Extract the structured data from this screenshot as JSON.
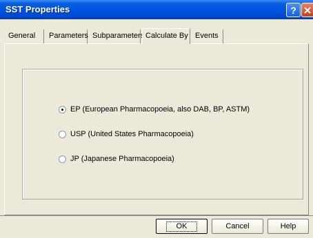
{
  "window": {
    "title": "SST Properties",
    "help_icon": "?",
    "close_icon": "close-icon"
  },
  "tabs": [
    {
      "label": "General"
    },
    {
      "label": "Parameters"
    },
    {
      "label": "Subparameters"
    },
    {
      "label": "Calculate By",
      "active": true
    },
    {
      "label": "Events"
    }
  ],
  "calculate_by": {
    "options": [
      {
        "label": "EP (European Pharmacopoeia, also DAB, BP, ASTM)",
        "selected": true
      },
      {
        "label": "USP (United States Pharmacopoeia)",
        "selected": false
      },
      {
        "label": "JP (Japanese Pharmacopoeia)",
        "selected": false
      }
    ]
  },
  "buttons": {
    "ok": "OK",
    "cancel": "Cancel",
    "help": "Help"
  }
}
